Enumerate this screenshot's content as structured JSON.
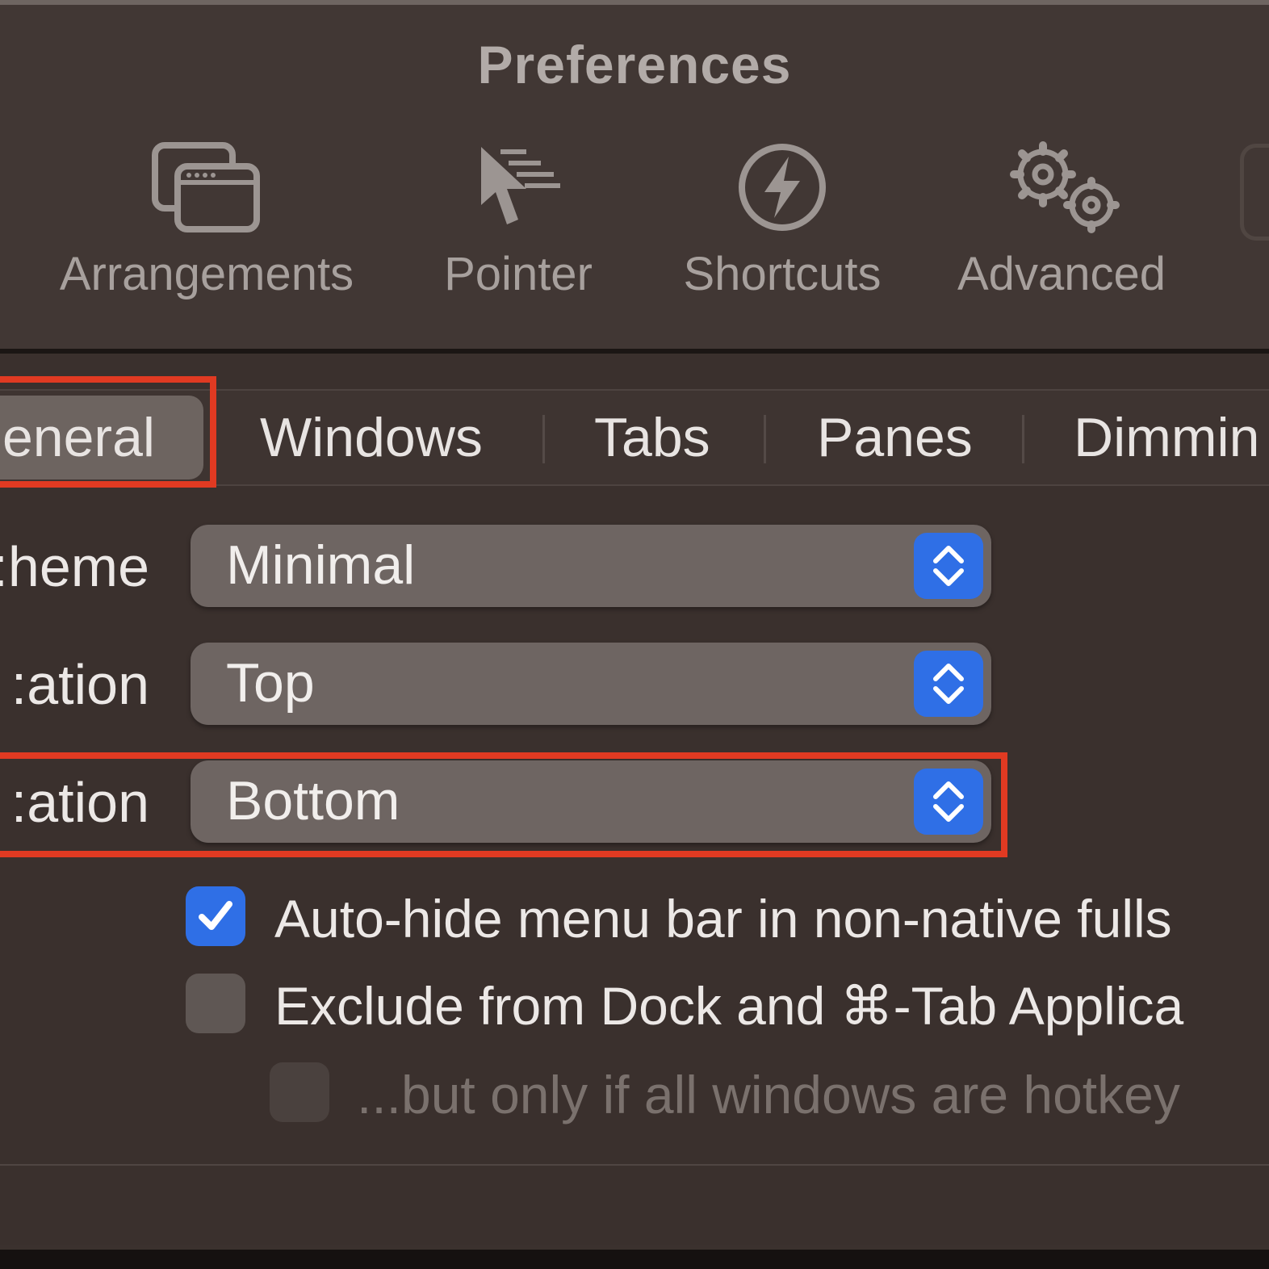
{
  "window": {
    "title": "Preferences"
  },
  "toolbar": {
    "items": [
      {
        "label": "Arrangements",
        "icon": "arrangements-icon"
      },
      {
        "label": "Pointer",
        "icon": "pointer-icon"
      },
      {
        "label": "Shortcuts",
        "icon": "shortcuts-bolt-icon"
      },
      {
        "label": "Advanced",
        "icon": "gears-icon"
      }
    ]
  },
  "tabs": [
    {
      "label": "eneral",
      "selected": true
    },
    {
      "label": "Windows"
    },
    {
      "label": "Tabs"
    },
    {
      "label": "Panes"
    },
    {
      "label": "Dimmin"
    }
  ],
  "settings": {
    "theme": {
      "label": "heme:",
      "value": "Minimal"
    },
    "tab_bar_location": {
      "label": "ation:",
      "value": "Top"
    },
    "status_bar_location": {
      "label": "ation:",
      "value": "Bottom"
    }
  },
  "checkboxes": [
    {
      "label": "Auto-hide menu bar in non-native fulls",
      "checked": true,
      "enabled": true
    },
    {
      "label": "Exclude from Dock and ⌘-Tab Applica",
      "checked": false,
      "enabled": true
    },
    {
      "label": "...but only if all windows are hotkey",
      "checked": false,
      "enabled": false
    }
  ],
  "colors": {
    "accent": "#2f6fe6",
    "highlight": "#e03a22",
    "background": "#3a302d"
  }
}
